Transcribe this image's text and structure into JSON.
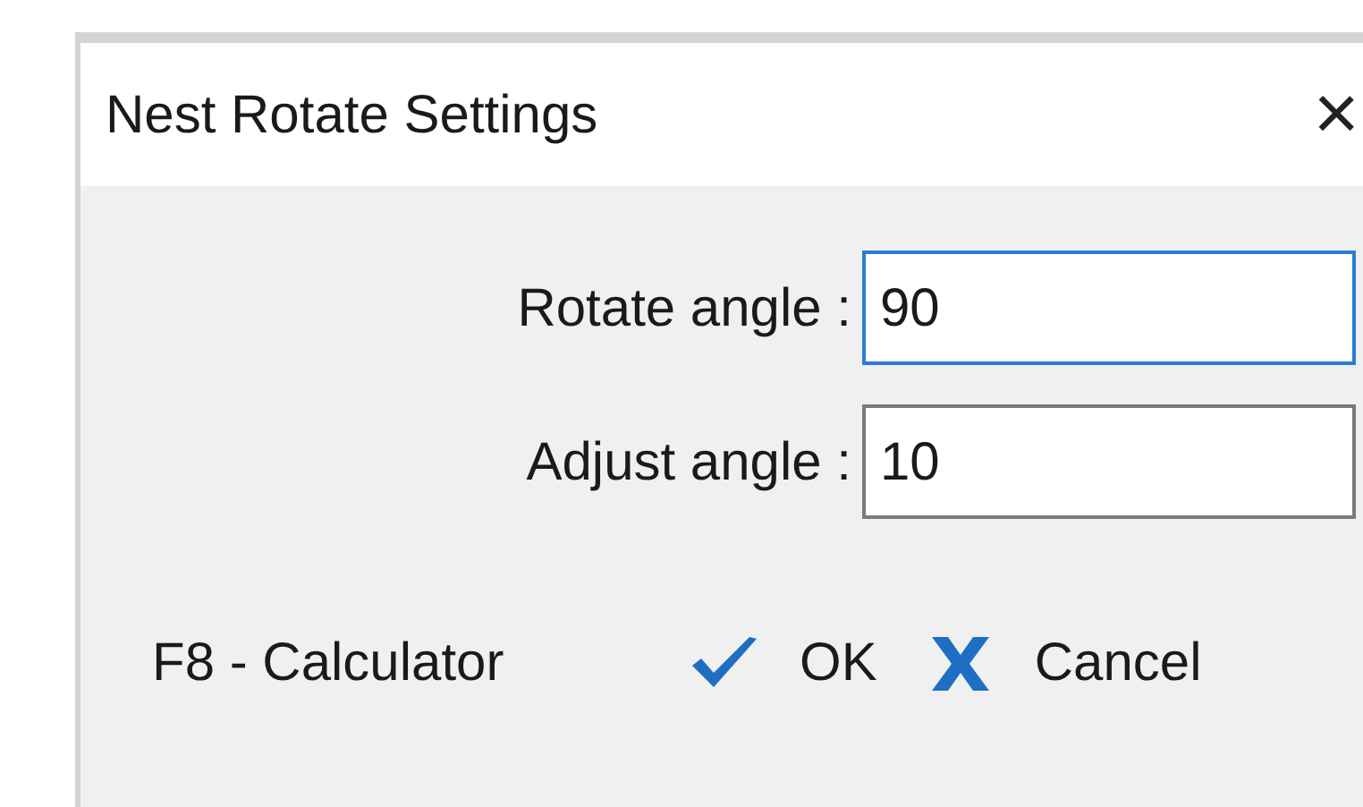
{
  "window": {
    "title": "Nest Rotate Settings",
    "close": "×"
  },
  "fields": [
    {
      "label": "Rotate angle :",
      "value": "90",
      "focused": true
    },
    {
      "label": "Adjust angle :",
      "value": "10",
      "focused": false
    }
  ],
  "hint": "F8 - Calculator",
  "buttons": [
    {
      "kind": "ok",
      "label": "OK"
    },
    {
      "kind": "cancel",
      "label": "Cancel"
    }
  ]
}
